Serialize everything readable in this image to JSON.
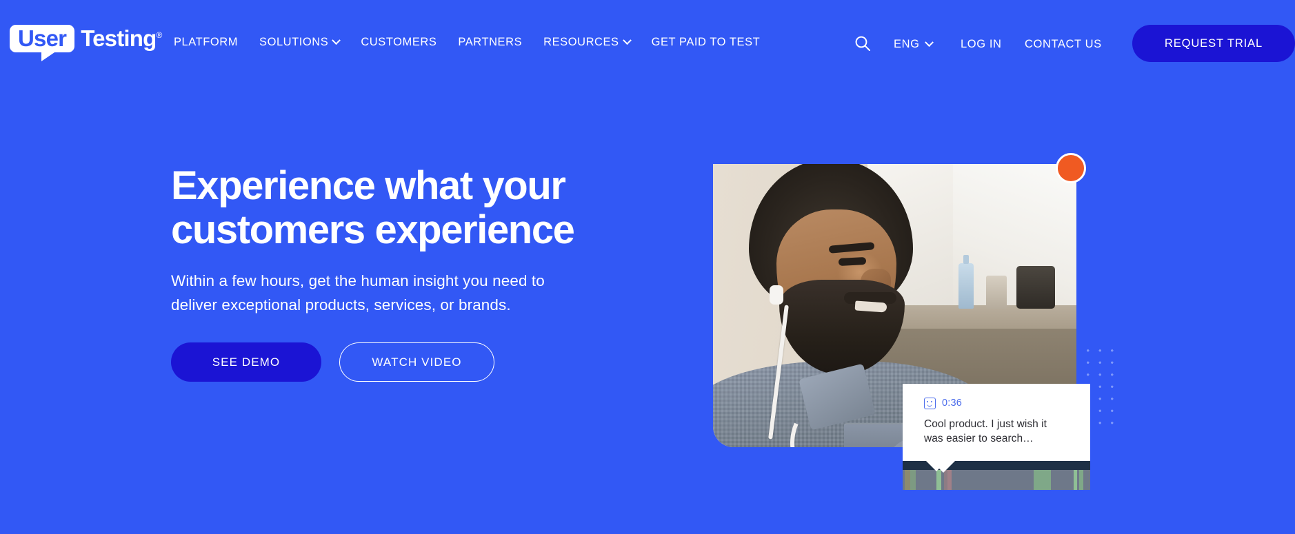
{
  "theme": {
    "brand_blue": "#3258F5",
    "deep_blue": "#1B14D4",
    "accent_orange": "#F05A22",
    "link_blue": "#4B6CEB",
    "timeline_dark": "#1E3045",
    "timeline_track": "#6E7889"
  },
  "nav": {
    "logo": {
      "badge_word": "User",
      "brand_word": "Testing",
      "trademark": "®"
    },
    "links": [
      {
        "label": "PLATFORM",
        "has_dropdown": false
      },
      {
        "label": "SOLUTIONS",
        "has_dropdown": true
      },
      {
        "label": "CUSTOMERS",
        "has_dropdown": false
      },
      {
        "label": "PARTNERS",
        "has_dropdown": false
      },
      {
        "label": "RESOURCES",
        "has_dropdown": true
      },
      {
        "label": "GET PAID TO TEST",
        "has_dropdown": false
      }
    ],
    "search_icon": "search-icon",
    "language": {
      "selected": "ENG",
      "chevron": "chevron-down-icon"
    },
    "login_label": "LOG IN",
    "contact_label": "CONTACT US",
    "trial_label": "REQUEST TRIAL"
  },
  "hero": {
    "headline": "Experience what your\ncustomers experience",
    "subheadline": "Within a few hours, get the human insight you need to\ndeliver exceptional products, services, or brands.",
    "primary_cta": "SEE DEMO",
    "secondary_cta": "WATCH VIDEO",
    "media": {
      "badge": "record-dot",
      "photo_alt": "man-with-earbuds-video-session"
    }
  },
  "callout": {
    "icon": "sentiment-face-icon",
    "timestamp": "0:36",
    "quote": "Cool product. I just wish it\nwas easier to search…"
  },
  "timeline": {
    "playhead_position_pct": 18,
    "segments": [
      {
        "left_pct": 1,
        "width_pct": 3,
        "color": "#8C8A6E"
      },
      {
        "left_pct": 4,
        "width_pct": 3,
        "color": "#7D9A82"
      },
      {
        "left_pct": 18,
        "width_pct": 2.5,
        "color": "#8FBF95"
      },
      {
        "left_pct": 22,
        "width_pct": 2,
        "color": "#8D7C84"
      },
      {
        "left_pct": 24,
        "width_pct": 2,
        "color": "#A08088"
      },
      {
        "left_pct": 70,
        "width_pct": 9,
        "color": "#7FA888"
      },
      {
        "left_pct": 91,
        "width_pct": 2,
        "color": "#8FBF95"
      },
      {
        "left_pct": 94,
        "width_pct": 2.5,
        "color": "#7FA888"
      }
    ]
  }
}
